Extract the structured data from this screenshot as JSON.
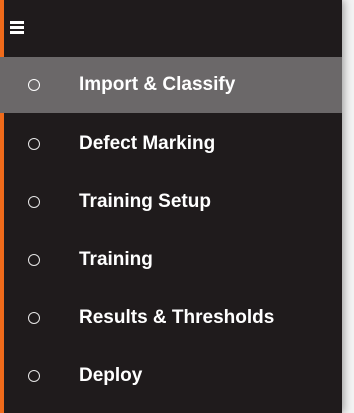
{
  "colors": {
    "panel_bg": "#1f1b1c",
    "active_bg": "#6b6869",
    "accent": "#ef6a1a",
    "text": "#ffffff"
  },
  "header": {
    "menu_icon": "hamburger-icon"
  },
  "menu": {
    "items": [
      {
        "label": "Import & Classify",
        "icon": "radio-circle-icon",
        "active": true
      },
      {
        "label": "Defect Marking",
        "icon": "radio-circle-icon",
        "active": false
      },
      {
        "label": "Training Setup",
        "icon": "radio-circle-icon",
        "active": false
      },
      {
        "label": "Training",
        "icon": "radio-circle-icon",
        "active": false
      },
      {
        "label": "Results & Thresholds",
        "icon": "radio-circle-icon",
        "active": false
      },
      {
        "label": "Deploy",
        "icon": "radio-circle-icon",
        "active": false
      }
    ]
  }
}
